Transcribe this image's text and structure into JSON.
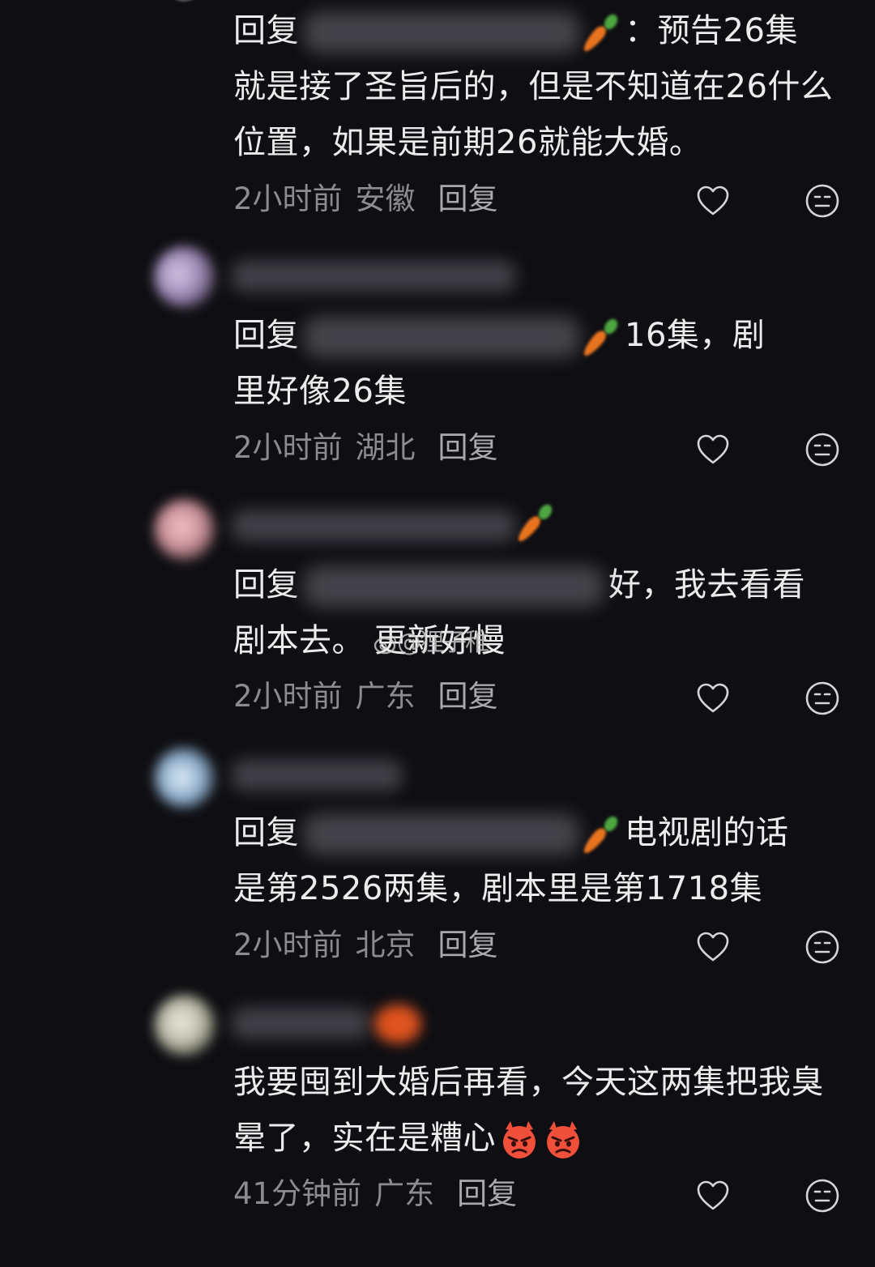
{
  "replies": [
    {
      "prefix": "回复",
      "text_line1_after": "：预告26集",
      "text_rest": "就是接了圣旨后的，但是不知道在26什么位置，如果是前期26就能大婚。",
      "time": "2小时前",
      "location": "安徽",
      "reply_label": "回复"
    },
    {
      "prefix": "回复",
      "text_line1_after": "16集，剧",
      "text_rest": "里好像26集",
      "time": "2小时前",
      "location": "湖北",
      "reply_label": "回复"
    },
    {
      "prefix": "回复",
      "text_line1_after": "好，我去看看",
      "text_rest": "剧本去。",
      "time": "2小时前",
      "location": "广东",
      "reply_label": "回复"
    },
    {
      "prefix": "回复",
      "text_line1_after": "电视剧的话",
      "text_rest": "是第2526两集，剧本里是第1718集",
      "time": "2小时前",
      "location": "北京",
      "reply_label": "回复"
    },
    {
      "text": "我要囤到大婚后再看，今天这两集把我臭晕了，实在是糟心",
      "time": "41分钟前",
      "location": "广东",
      "reply_label": "回复"
    }
  ],
  "watermark": "@狸子稚",
  "watermark_overlay": "更新好慢",
  "icons": {
    "like": "heart-outline-icon",
    "dislike": "neutral-face-icon",
    "emoji": "angry-devil-emoji",
    "mention_badge": "carrot-icon",
    "watermark_logo": "weibo-logo-icon"
  },
  "colors": {
    "background": "#0f0f13",
    "text": "#ececec",
    "meta": "#8b8b90",
    "carrot": "#e8731e"
  }
}
